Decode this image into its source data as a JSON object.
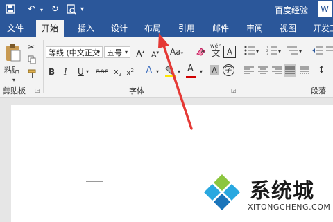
{
  "titlebar": {
    "doc_title": "百度经验",
    "window_badge": "W"
  },
  "tabs": [
    "文件",
    "开始",
    "插入",
    "设计",
    "布局",
    "引用",
    "邮件",
    "审阅",
    "视图",
    "开发工"
  ],
  "active_tab": "开始",
  "clipboard": {
    "paste_label": "粘贴",
    "group_label": "剪贴板"
  },
  "font": {
    "font_name": "等线 (中文正文",
    "font_size": "五号",
    "group_label": "字体",
    "phonetic_guide_label": "wén",
    "change_case_label": "Aa"
  },
  "paragraph": {
    "group_label": "段落"
  },
  "watermark": {
    "text": "系统城",
    "url": "XITONGCHENG.COM"
  },
  "colors": {
    "accent": "#2b579a",
    "ribbon_bg": "#f3f3f3",
    "arrow": "#e53935",
    "highlight_yellow": "#ffe600",
    "font_color_red": "#d00000"
  }
}
